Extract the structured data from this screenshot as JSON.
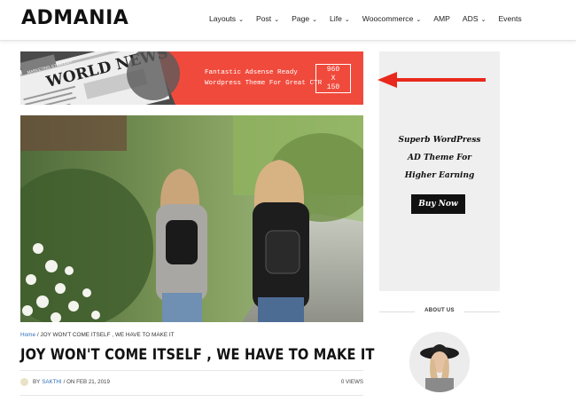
{
  "header": {
    "logo": "ADMANIA",
    "nav": [
      {
        "label": "Layouts",
        "dropdown": true
      },
      {
        "label": "Post",
        "dropdown": true
      },
      {
        "label": "Page",
        "dropdown": true
      },
      {
        "label": "Life",
        "dropdown": true
      },
      {
        "label": "Woocommerce",
        "dropdown": true
      },
      {
        "label": "AMP",
        "dropdown": false
      },
      {
        "label": "ADS",
        "dropdown": true
      },
      {
        "label": "Events",
        "dropdown": false
      }
    ]
  },
  "banner": {
    "line1": "Fantastic Adsense Ready",
    "line2": "Wordpress Theme For Great CTR",
    "size_w": "960",
    "size_x": "X",
    "size_h": "150",
    "bg_color": "#f04a3c"
  },
  "article": {
    "breadcrumb_home": "Home",
    "breadcrumb_sep": " / ",
    "breadcrumb_current": "JOY WON'T COME ITSELF , WE HAVE TO MAKE IT",
    "title": "JOY WON'T COME ITSELF , WE HAVE TO MAKE IT",
    "by": "BY",
    "author": "SAKTHI",
    "date_prefix": "/ ON",
    "date": "FEB 21, 2019",
    "views": "0 VIEWS"
  },
  "sidebar": {
    "ad_line1": "Superb WordPress",
    "ad_line2": "AD Theme For",
    "ad_line3": "Higher Earning",
    "buy_button": "Buy Now",
    "about_title": "ABOUT US",
    "arrow_color": "#e8281c"
  }
}
